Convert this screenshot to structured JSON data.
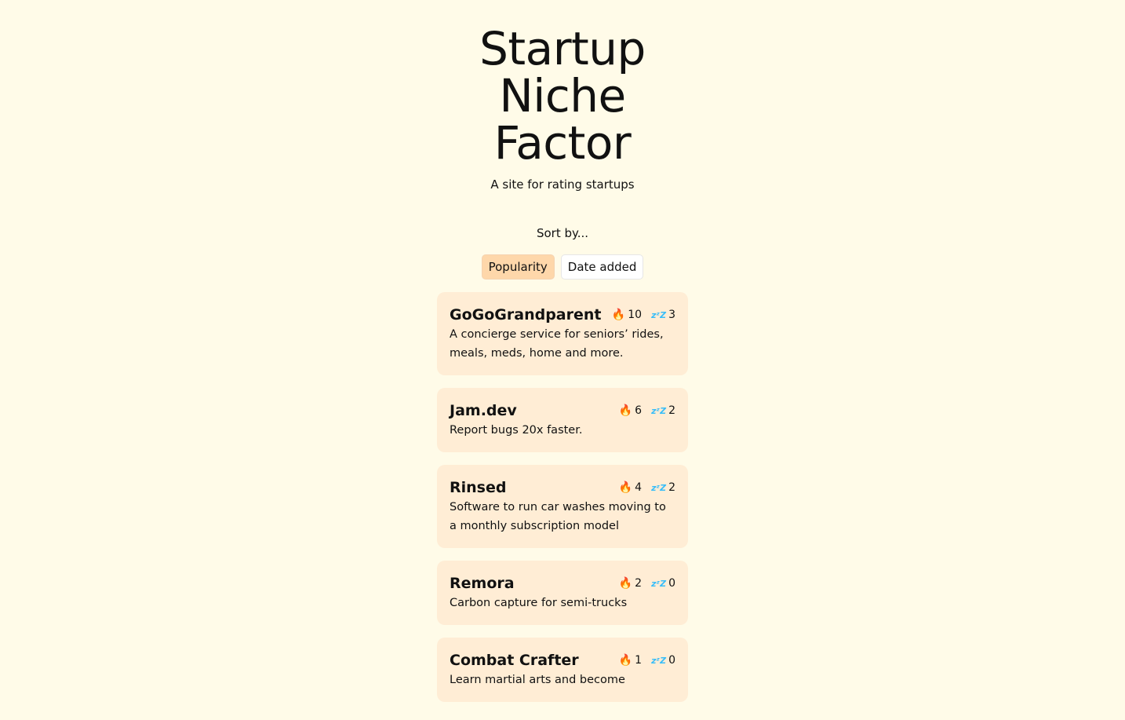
{
  "header": {
    "title_lines": [
      "Startup",
      "Niche",
      "Factor"
    ],
    "subtitle": "A site for rating startups"
  },
  "sort": {
    "label": "Sort by...",
    "options": [
      {
        "label": "Popularity",
        "active": true
      },
      {
        "label": "Date added",
        "active": false
      }
    ]
  },
  "colors": {
    "background": "#fffbe8",
    "card": "#ffedd5",
    "active_button": "#fed7aa"
  },
  "icons": {
    "hot": "fire-icon",
    "sleepy": "zzz-icon"
  },
  "startups": [
    {
      "name": "GoGoGrandparent",
      "hot": "10",
      "sleepy": "3",
      "description": "A concierge service for seniors’ rides, meals, meds, home and more."
    },
    {
      "name": "Jam.dev",
      "hot": "6",
      "sleepy": "2",
      "description": "Report bugs 20x faster."
    },
    {
      "name": "Rinsed",
      "hot": "4",
      "sleepy": "2",
      "description": "Software to run car washes moving to a monthly subscription model"
    },
    {
      "name": "Remora",
      "hot": "2",
      "sleepy": "0",
      "description": "Carbon capture for semi-trucks"
    },
    {
      "name": "Combat Crafter",
      "hot": "1",
      "sleepy": "0",
      "description": "Learn martial arts and become"
    }
  ]
}
